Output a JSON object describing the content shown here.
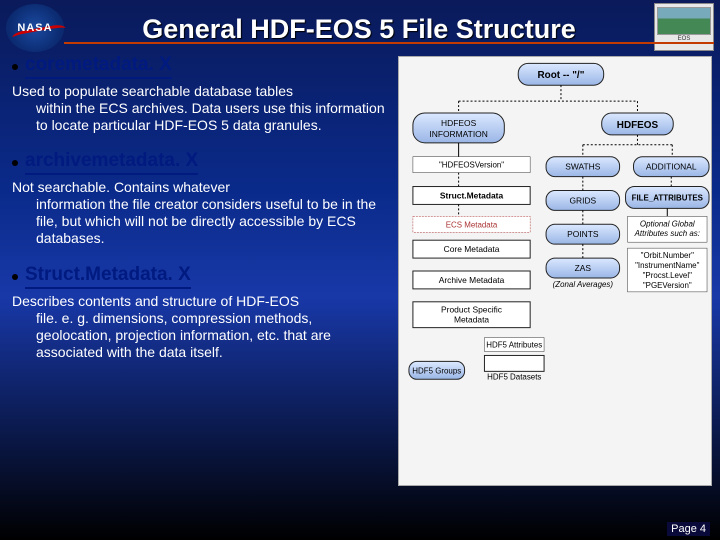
{
  "title": "General HDF-EOS 5 File Structure",
  "sections": [
    {
      "heading": "coremetadata. X",
      "desc_first": "Used to populate searchable database tables",
      "desc_rest": "within the ECS archives. Data users use this information to locate particular HDF-EOS 5 data granules."
    },
    {
      "heading": "archivemetadata. X",
      "desc_first": "Not searchable. Contains whatever",
      "desc_rest": "information the file creator considers useful to be in the file, but which will not be directly accessible by ECS databases."
    },
    {
      "heading": "Struct.Metadata. X",
      "desc_first": "Describes contents and structure of HDF-EOS",
      "desc_rest": "file. e. g. dimensions, compression methods, geolocation, projection information, etc. that are associated with the data itself."
    }
  ],
  "diagram": {
    "root": "Root -- \"/\"",
    "group_left": "HDFEOS INFORMATION",
    "group_right": "HDFEOS",
    "left_items": [
      "\"HDFEOSVersion\"",
      "Struct.Metadata",
      "ECS Metadata",
      "Core Metadata",
      "Archive Metadata",
      "Product Specific Metadata"
    ],
    "right_items": [
      "SWATHS",
      "GRIDS",
      "POINTS",
      "ZAS"
    ],
    "right_sub": "(Zonal Averages)",
    "additional": "ADDITIONAL",
    "file_attrs": "FILE_ATTRIBUTES",
    "file_attr_note1": "Optional Global Attributes such as:",
    "file_attr_note2": "\"Orbit.Number\" \"InstrumentName\" \"Procst.Level\" \"PGEVersion\"",
    "legend_group": "HDF5 Groups",
    "legend_dataset": "HDF5 Datasets",
    "legend_attr": "HDF5 Attributes"
  },
  "footer": "Page 4"
}
